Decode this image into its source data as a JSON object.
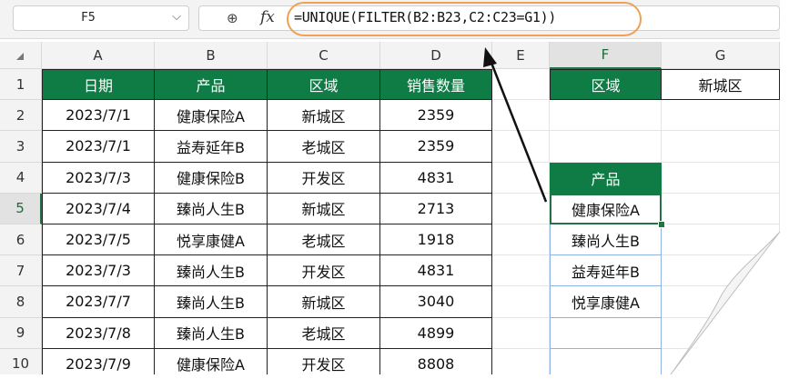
{
  "formula_bar": {
    "name_box": "F5",
    "formula": "=UNIQUE(FILTER(B2:B23,C2:C23=G1))"
  },
  "icons": [
    "chevron-down-icon",
    "zoom-icon",
    "fx-icon"
  ],
  "columns": [
    "A",
    "B",
    "C",
    "D",
    "E",
    "F",
    "G"
  ],
  "rows": [
    "1",
    "2",
    "3",
    "4",
    "5",
    "6",
    "7",
    "8",
    "9",
    "10"
  ],
  "table": {
    "headers": [
      "日期",
      "产品",
      "区域",
      "销售数量"
    ],
    "rows": [
      [
        "2023/7/1",
        "健康保险A",
        "新城区",
        "2359"
      ],
      [
        "2023/7/1",
        "益寿延年B",
        "老城区",
        "2359"
      ],
      [
        "2023/7/3",
        "健康保险B",
        "开发区",
        "4831"
      ],
      [
        "2023/7/4",
        "臻尚人生B",
        "新城区",
        "2713"
      ],
      [
        "2023/7/5",
        "悦享康健A",
        "老城区",
        "1918"
      ],
      [
        "2023/7/3",
        "臻尚人生B",
        "开发区",
        "4831"
      ],
      [
        "2023/7/7",
        "臻尚人生B",
        "新城区",
        "3040"
      ],
      [
        "2023/7/8",
        "臻尚人生B",
        "老城区",
        "4899"
      ],
      [
        "2023/7/9",
        "健康保险A",
        "开发区",
        "8808"
      ]
    ]
  },
  "criteria": {
    "label": "区域",
    "value": "新城区"
  },
  "result": {
    "header": "产品",
    "values": [
      "健康保险A",
      "臻尚人生B",
      "益寿延年B",
      "悦享康健A",
      "",
      ""
    ]
  },
  "colors": {
    "header_green": "#0f7b45",
    "highlight_oval": "#f0a155",
    "selection": "#217346"
  }
}
